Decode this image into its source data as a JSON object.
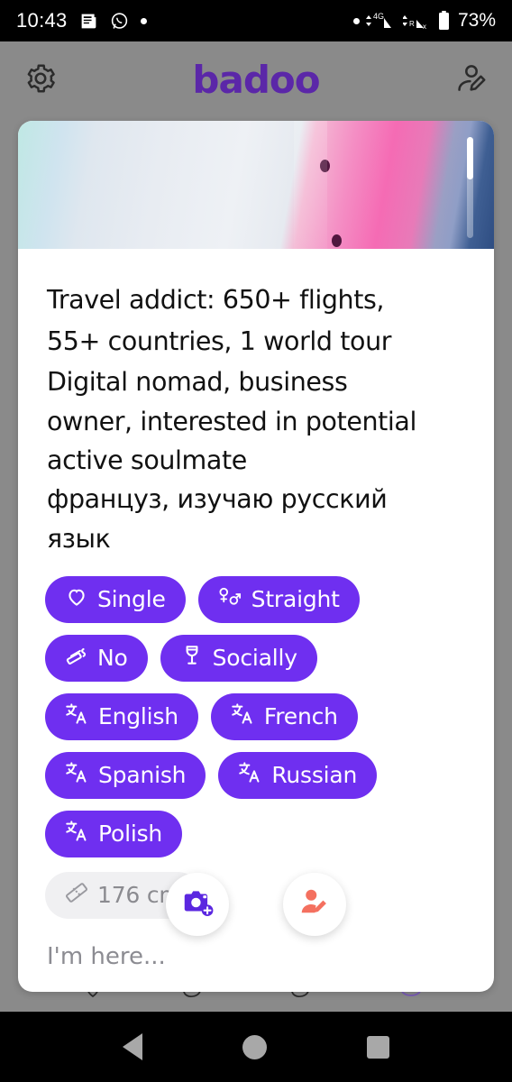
{
  "status_bar": {
    "time": "10:43",
    "battery_percent": "73%",
    "network": "4G",
    "icons": [
      "news-icon",
      "whatsapp-icon",
      "dot-indicator",
      "dot-indicator",
      "signal-4g-icon",
      "signal-roaming-icon",
      "battery-icon"
    ]
  },
  "header": {
    "settings_icon": "gear-icon",
    "logo": "badoo",
    "logo_color": "#5b27a8",
    "edit_profile_icon": "person-edit-icon"
  },
  "profile_card": {
    "photo": {
      "scroll_indicator": "photo-progress-bar"
    },
    "bio_lines": [
      "Travel addict: 650+ flights,",
      "55+ countries, 1 world tour",
      "Digital nomad, business",
      "owner, interested in potential",
      "active soulmate",
      "француз, изучаю русский",
      "язык"
    ],
    "badges": [
      {
        "label": "Single",
        "icon": "heart-icon",
        "style": "active"
      },
      {
        "label": "Straight",
        "icon": "gender-icon",
        "style": "active"
      },
      {
        "label": "No",
        "icon": "cigarette-icon",
        "style": "active"
      },
      {
        "label": "Socially",
        "icon": "wine-glass-icon",
        "style": "active"
      },
      {
        "label": "English",
        "icon": "translate-icon",
        "style": "active"
      },
      {
        "label": "French",
        "icon": "translate-icon",
        "style": "active"
      },
      {
        "label": "Spanish",
        "icon": "translate-icon",
        "style": "active"
      },
      {
        "label": "Russian",
        "icon": "translate-icon",
        "style": "active"
      },
      {
        "label": "Polish",
        "icon": "translate-icon",
        "style": "active"
      }
    ],
    "height_badge": {
      "label": "176 cm",
      "icon": "ruler-icon",
      "style": "muted"
    },
    "actions": [
      {
        "name": "add-photo",
        "icon": "camera-plus-icon",
        "color": "#6f2ff0"
      },
      {
        "name": "edit-profile",
        "icon": "person-edit-icon",
        "color": "#f4705f"
      }
    ],
    "location_placeholder": "I'm here..."
  },
  "android_nav": {
    "back": "back-triangle-icon",
    "home": "home-circle-icon",
    "recents": "recents-square-icon"
  },
  "colors": {
    "chip_purple": "#6f2ff0",
    "chip_muted_bg": "#f0f0f2",
    "brand_purple": "#5b27a8",
    "accent_coral": "#f4705f",
    "page_bg": "#8a8a8a"
  }
}
